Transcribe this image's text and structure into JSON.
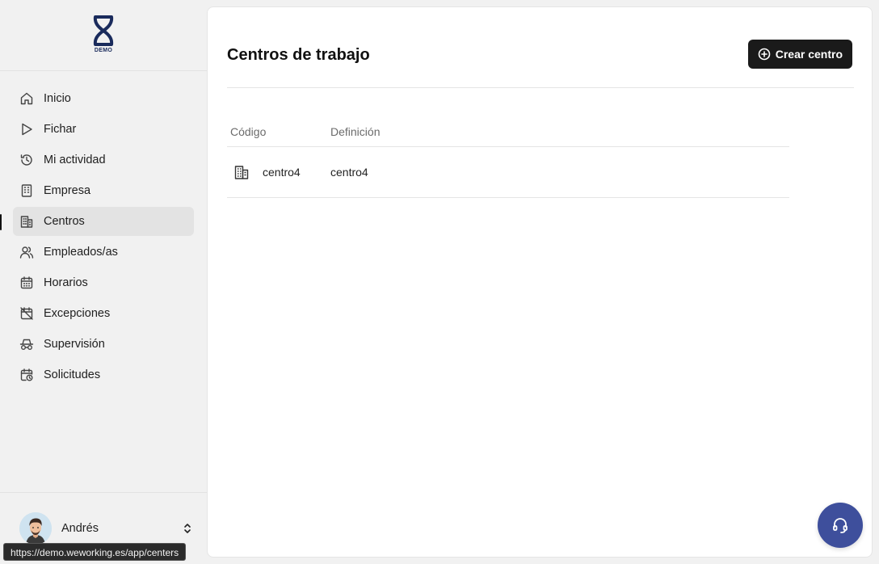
{
  "app": {
    "logo_text": "DEMO",
    "brand_color": "#1a2b5c"
  },
  "sidebar": {
    "items": [
      {
        "label": "Inicio",
        "icon": "home-icon"
      },
      {
        "label": "Fichar",
        "icon": "play-icon"
      },
      {
        "label": "Mi actividad",
        "icon": "history-icon"
      },
      {
        "label": "Empresa",
        "icon": "building-icon"
      },
      {
        "label": "Centros",
        "icon": "buildings-icon",
        "active": true
      },
      {
        "label": "Empleados/as",
        "icon": "users-icon"
      },
      {
        "label": "Horarios",
        "icon": "calendar-icon"
      },
      {
        "label": "Excepciones",
        "icon": "calendar-off-icon"
      },
      {
        "label": "Supervisión",
        "icon": "incognito-icon"
      },
      {
        "label": "Solicitudes",
        "icon": "calendar-clock-icon"
      }
    ],
    "user": {
      "name": "Andrés"
    }
  },
  "main": {
    "title": "Centros de trabajo",
    "create_button": "Crear centro",
    "table": {
      "columns": [
        "Código",
        "Definición"
      ],
      "rows": [
        {
          "codigo": "centro4",
          "definicion": "centro4",
          "icon": "buildings-icon"
        }
      ]
    }
  },
  "status_bar": {
    "url": "https://demo.weworking.es/app/centers"
  },
  "help": {
    "icon": "headset-icon",
    "color": "#3e4f9c"
  }
}
